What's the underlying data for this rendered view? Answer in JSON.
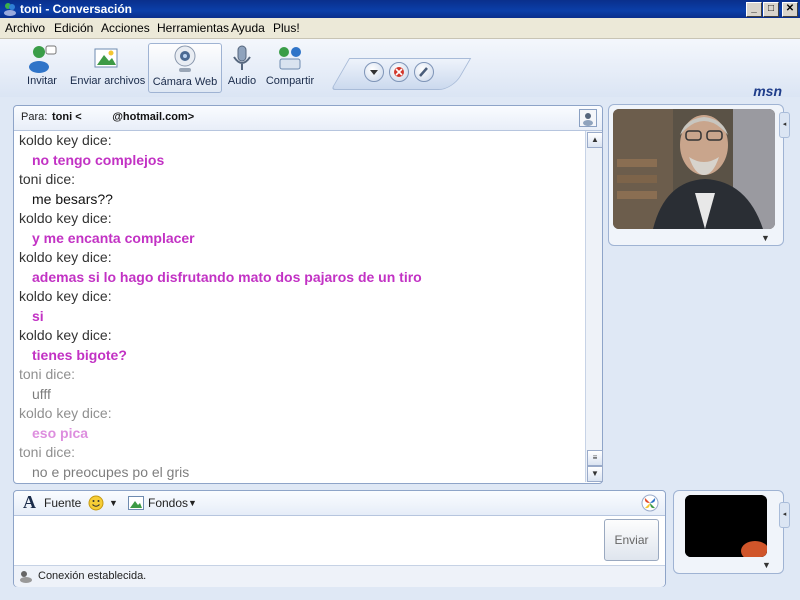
{
  "window": {
    "title": "toni - Conversación"
  },
  "menu": [
    "Archivo",
    "Edición",
    "Acciones",
    "Herramientas",
    "Ayuda",
    "Plus!"
  ],
  "toolbar": {
    "tools": [
      {
        "label": "Invitar"
      },
      {
        "label": "Enviar archivos"
      },
      {
        "label": "Cámara Web"
      },
      {
        "label": "Audio"
      },
      {
        "label": "Compartir"
      }
    ],
    "logo": "msn"
  },
  "to": {
    "label": "Para:",
    "value": "toni <          @hotmail.com>"
  },
  "messages": [
    {
      "sender": "koldo key dice:",
      "text": "no tengo complejos",
      "style": "pink"
    },
    {
      "sender": "toni dice:",
      "text": "me besars??",
      "style": "dark"
    },
    {
      "sender": "koldo key dice:",
      "text": "y me encanta complacer",
      "style": "pink"
    },
    {
      "sender": "koldo key dice:",
      "text": "ademas si lo hago disfrutando mato dos pajaros de un tiro",
      "style": "pink"
    },
    {
      "sender": "koldo key dice:",
      "text": "si",
      "style": "pink"
    },
    {
      "sender": "koldo key dice:",
      "text": "tienes bigote?",
      "style": "pink"
    },
    {
      "sender": "toni dice:",
      "text": "ufff",
      "style": "faded-dark"
    },
    {
      "sender": "koldo key dice:",
      "text": "eso pica",
      "style": "faded-pink"
    },
    {
      "sender": "toni dice:",
      "text": "no e preocupes po el gris",
      "style": "faded-dark"
    }
  ],
  "compose": {
    "font_label": "Fuente",
    "backgrounds_label": "Fondos",
    "send_label": "Enviar",
    "status": "Conexión establecida."
  },
  "colors": {
    "pink": "#c232c4",
    "title_bar": "#0b3fa9"
  }
}
